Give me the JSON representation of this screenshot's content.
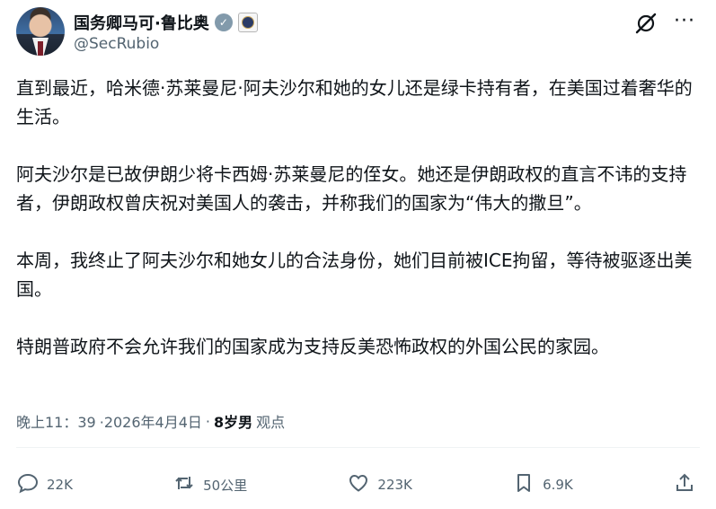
{
  "author": {
    "display_name": "国务卿马可·鲁比奥",
    "handle": "@SecRubio",
    "verified_glyph": "✓"
  },
  "header_icons": [
    "grok-icon",
    "more-icon"
  ],
  "more_glyph": "···",
  "tweet": {
    "paragraphs": [
      "直到最近，哈米德·苏莱曼尼·阿夫沙尔和她的女儿还是绿卡持有者，在美国过着奢华的生活。",
      "阿夫沙尔是已故伊朗少将卡西姆·苏莱曼尼的侄女。她还是伊朗政权的直言不讳的支持者，伊朗政权曾庆祝对美国人的袭击，并称我们的国家为“伟大的撒旦”。",
      "本周，我终止了阿夫沙尔和她女儿的合法身份，她们目前被ICE拘留，等待被驱逐出美国。",
      "特朗普政府不会允许我们的国家成为支持反美恐怖政权的外国公民的家园。"
    ]
  },
  "meta": {
    "time": "晚上11：39",
    "date": "·2026年4月4日",
    "separator": "·",
    "views_count": "8岁男",
    "views_label": "观点"
  },
  "actions": {
    "reply_count": "22K",
    "repost_count": "50公里",
    "like_count": "223K",
    "bookmark_count": "6.9K"
  },
  "colors": {
    "text": "#0f1419",
    "secondary": "#536471",
    "verified": "#829aab",
    "divider": "#eff3f4"
  }
}
